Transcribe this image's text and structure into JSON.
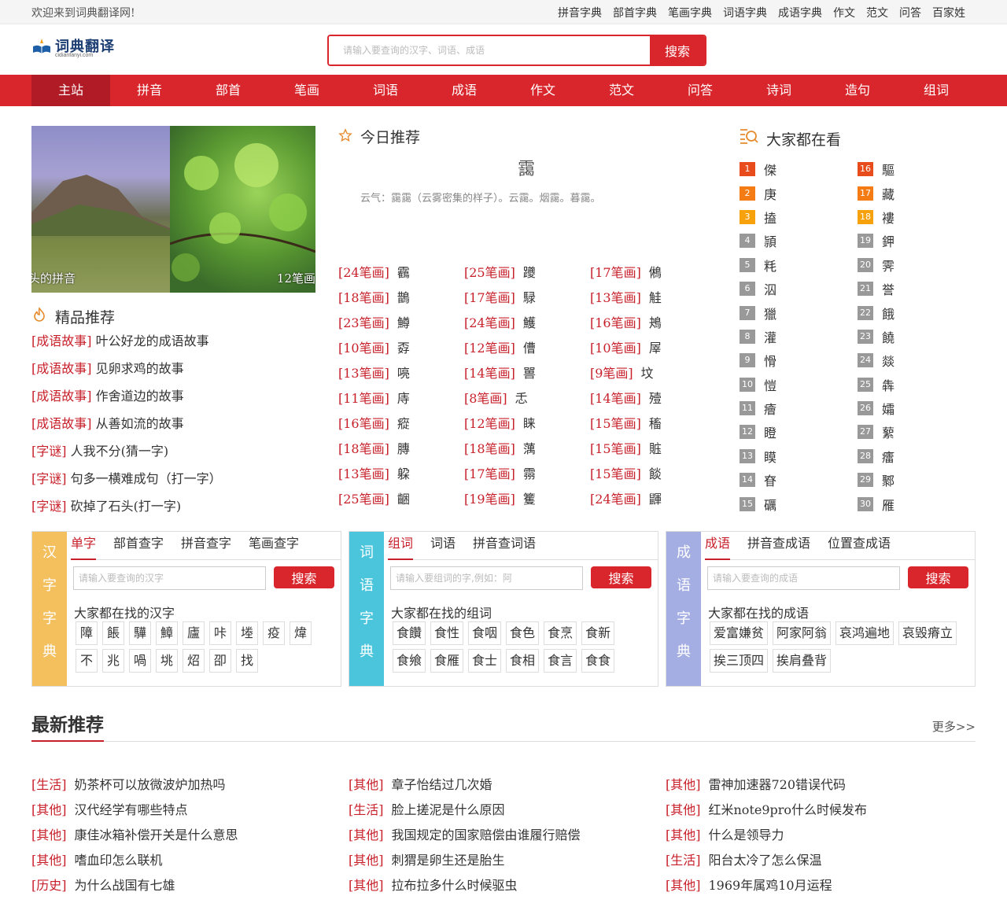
{
  "topbar": {
    "welcome": "欢迎来到词典翻译网!",
    "links": [
      "拼音字典",
      "部首字典",
      "笔画字典",
      "词语字典",
      "成语字典",
      "作文",
      "范文",
      "问答",
      "百家姓"
    ]
  },
  "logo": {
    "name": "词典翻译",
    "url": "cidianfanyi.com"
  },
  "search": {
    "placeholder": "请输入要查询的汉字、词语、成语",
    "button": "搜索"
  },
  "nav": [
    "主站",
    "拼音",
    "部首",
    "笔画",
    "词语",
    "成语",
    "作文",
    "范文",
    "问答",
    "诗词",
    "造句",
    "组词"
  ],
  "slider": {
    "caption_left": "头的拼音",
    "caption_right": "12笔画"
  },
  "jingpin": {
    "title": "精品推荐",
    "items": [
      {
        "tag": "[成语故事]",
        "text": "叶公好龙的成语故事"
      },
      {
        "tag": "[成语故事]",
        "text": "见卵求鸡的故事"
      },
      {
        "tag": "[成语故事]",
        "text": "作舍道边的故事"
      },
      {
        "tag": "[成语故事]",
        "text": "从善如流的故事"
      },
      {
        "tag": "[字谜]",
        "text": "人我不分(猜一字)"
      },
      {
        "tag": "[字谜]",
        "text": "句多一横难成句（打一字）"
      },
      {
        "tag": "[字谜]",
        "text": "砍掉了石头(打一字)"
      }
    ]
  },
  "today": {
    "title": "今日推荐",
    "word": "靄",
    "desc": "云气：靄靄（云雾密集的样子）。云靄。烟靄。暮靄。"
  },
  "strokes": [
    [
      {
        "s": "[24笔画]",
        "c": "靏"
      },
      {
        "s": "[25笔画]",
        "c": "躨"
      },
      {
        "s": "[17笔画]",
        "c": "鵂"
      }
    ],
    [
      {
        "s": "[18笔画]",
        "c": "鵲"
      },
      {
        "s": "[17笔画]",
        "c": "騄"
      },
      {
        "s": "[13笔画]",
        "c": "觟"
      }
    ],
    [
      {
        "s": "[23笔画]",
        "c": "鱒"
      },
      {
        "s": "[24笔画]",
        "c": "鱯"
      },
      {
        "s": "[16笔画]",
        "c": "鴂"
      }
    ],
    [
      {
        "s": "[10笔画]",
        "c": "孬"
      },
      {
        "s": "[12笔画]",
        "c": "傮"
      },
      {
        "s": "[10笔画]",
        "c": "屖"
      }
    ],
    [
      {
        "s": "[13笔画]",
        "c": "喨"
      },
      {
        "s": "[14笔画]",
        "c": "嘼"
      },
      {
        "s": "[9笔画]",
        "c": "坟"
      }
    ],
    [
      {
        "s": "[11笔画]",
        "c": "庤"
      },
      {
        "s": "[8笔画]",
        "c": "忎"
      },
      {
        "s": "[14笔画]",
        "c": "殪"
      }
    ],
    [
      {
        "s": "[16笔画]",
        "c": "瘲"
      },
      {
        "s": "[12笔画]",
        "c": "睐"
      },
      {
        "s": "[15笔画]",
        "c": "稸"
      }
    ],
    [
      {
        "s": "[18笔画]",
        "c": "膞"
      },
      {
        "s": "[18笔画]",
        "c": "蕅"
      },
      {
        "s": "[15笔画]",
        "c": "賘"
      }
    ],
    [
      {
        "s": "[13笔画]",
        "c": "躱"
      },
      {
        "s": "[17笔画]",
        "c": "霛"
      },
      {
        "s": "[15笔画]",
        "c": "餤"
      }
    ],
    [
      {
        "s": "[25笔画]",
        "c": "齫"
      },
      {
        "s": "[19笔画]",
        "c": "籆"
      },
      {
        "s": "[24笔画]",
        "c": "鼲"
      }
    ]
  ],
  "hot": {
    "title": "大家都在看",
    "left": [
      {
        "n": "1",
        "c": "傑"
      },
      {
        "n": "2",
        "c": "庚"
      },
      {
        "n": "3",
        "c": "搕"
      },
      {
        "n": "4",
        "c": "頴"
      },
      {
        "n": "5",
        "c": "粍"
      },
      {
        "n": "6",
        "c": "泅"
      },
      {
        "n": "7",
        "c": "獵"
      },
      {
        "n": "8",
        "c": "灌"
      },
      {
        "n": "9",
        "c": "愲"
      },
      {
        "n": "10",
        "c": "愷"
      },
      {
        "n": "11",
        "c": "癐"
      },
      {
        "n": "12",
        "c": "瞪"
      },
      {
        "n": "13",
        "c": "瞙"
      },
      {
        "n": "14",
        "c": "眘"
      },
      {
        "n": "15",
        "c": "礪"
      }
    ],
    "right": [
      {
        "n": "16",
        "c": "驅"
      },
      {
        "n": "17",
        "c": "藏"
      },
      {
        "n": "18",
        "c": "褸"
      },
      {
        "n": "19",
        "c": "鉀"
      },
      {
        "n": "20",
        "c": "霁"
      },
      {
        "n": "21",
        "c": "誉"
      },
      {
        "n": "22",
        "c": "餓"
      },
      {
        "n": "23",
        "c": "饒"
      },
      {
        "n": "24",
        "c": "燚"
      },
      {
        "n": "25",
        "c": "犇"
      },
      {
        "n": "26",
        "c": "孀"
      },
      {
        "n": "27",
        "c": "蕠"
      },
      {
        "n": "28",
        "c": "癗"
      },
      {
        "n": "29",
        "c": "鄹"
      },
      {
        "n": "30",
        "c": "雁"
      }
    ]
  },
  "panels": [
    {
      "side": [
        "汉",
        "字",
        "字",
        "典"
      ],
      "color": "#f4bf5d",
      "tabs": [
        "单字",
        "部首查字",
        "拼音查字",
        "笔画查字"
      ],
      "placeholder": "请输入要查询的汉字",
      "button": "搜索",
      "label": "大家都在找的汉字",
      "chips": [
        "障",
        "餦",
        "驊",
        "鱆",
        "廬",
        "咔",
        "堘",
        "疫",
        "煒",
        "不",
        "兆",
        "喎",
        "垗",
        "炤",
        "卲",
        "找"
      ]
    },
    {
      "side": [
        "词",
        "语",
        "字",
        "典"
      ],
      "color": "#4ac5dc",
      "tabs": [
        "组词",
        "词语",
        "拼音查词语"
      ],
      "placeholder": "请输入要组词的字,例如：阿",
      "button": "搜索",
      "label": "大家都在找的组词",
      "chips": [
        "食饡",
        "食性",
        "食咽",
        "食色",
        "食烹",
        "食新",
        "食飨",
        "食雁",
        "食士",
        "食相",
        "食言",
        "食食"
      ]
    },
    {
      "side": [
        "成",
        "语",
        "字",
        "典"
      ],
      "color": "#a5aee3",
      "tabs": [
        "成语",
        "拼音查成语",
        "位置查成语"
      ],
      "placeholder": "请输入要查询的成语",
      "button": "搜索",
      "label": "大家都在找的成语",
      "chips": [
        "爱富嫌贫",
        "阿家阿翁",
        "哀鸿遍地",
        "哀毁瘠立",
        "挨三顶四",
        "挨肩叠背"
      ]
    }
  ],
  "latest": {
    "title": "最新推荐",
    "more": "更多>>",
    "cols": [
      [
        {
          "tag": "[生活]",
          "text": "奶茶杯可以放微波炉加热吗"
        },
        {
          "tag": "[其他]",
          "text": "汉代经学有哪些特点"
        },
        {
          "tag": "[其他]",
          "text": "康佳冰箱补偿开关是什么意思"
        },
        {
          "tag": "[其他]",
          "text": "嗜血印怎么联机"
        },
        {
          "tag": "[历史]",
          "text": "为什么战国有七雄"
        }
      ],
      [
        {
          "tag": "[其他]",
          "text": "章子怡结过几次婚"
        },
        {
          "tag": "[生活]",
          "text": "脸上搓泥是什么原因"
        },
        {
          "tag": "[其他]",
          "text": "我国规定的国家赔偿由谁履行赔偿"
        },
        {
          "tag": "[其他]",
          "text": "刺猬是卵生还是胎生"
        },
        {
          "tag": "[其他]",
          "text": "拉布拉多什么时候驱虫"
        }
      ],
      [
        {
          "tag": "[其他]",
          "text": "雷神加速器720错误代码"
        },
        {
          "tag": "[其他]",
          "text": "红米note9pro什么时候发布"
        },
        {
          "tag": "[其他]",
          "text": "什么是领导力"
        },
        {
          "tag": "[生活]",
          "text": "阳台太冷了怎么保温"
        },
        {
          "tag": "[其他]",
          "text": "1969年属鸡10月运程"
        }
      ]
    ]
  }
}
